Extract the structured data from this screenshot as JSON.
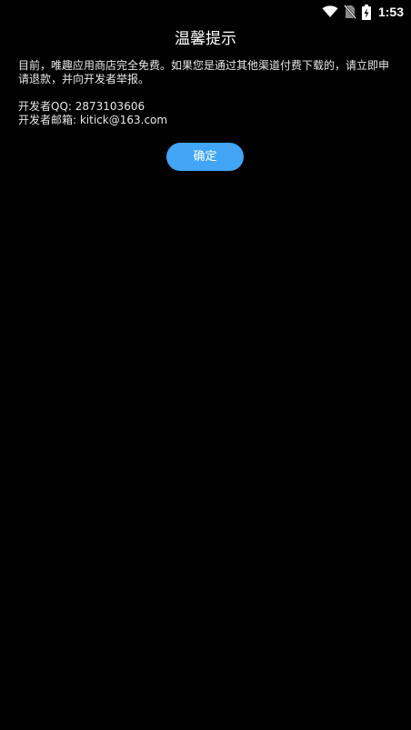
{
  "status_bar": {
    "time": "1:53",
    "icons": [
      "wifi-icon",
      "no-sim-icon",
      "battery-charging-icon"
    ]
  },
  "dialog": {
    "title": "温馨提示",
    "message_line1": "目前，唯趣应用商店完全免费。如果您是通过其他渠道付费下载的，请立即申",
    "message_line2": "请退款，并向开发者举报。",
    "developer_qq": "开发者QQ: 2873103606",
    "developer_email": "开发者邮箱: kitick@163.com",
    "confirm_label": "确定"
  },
  "colors": {
    "background": "#000000",
    "button": "#42a5f5",
    "text": "#ffffff"
  }
}
